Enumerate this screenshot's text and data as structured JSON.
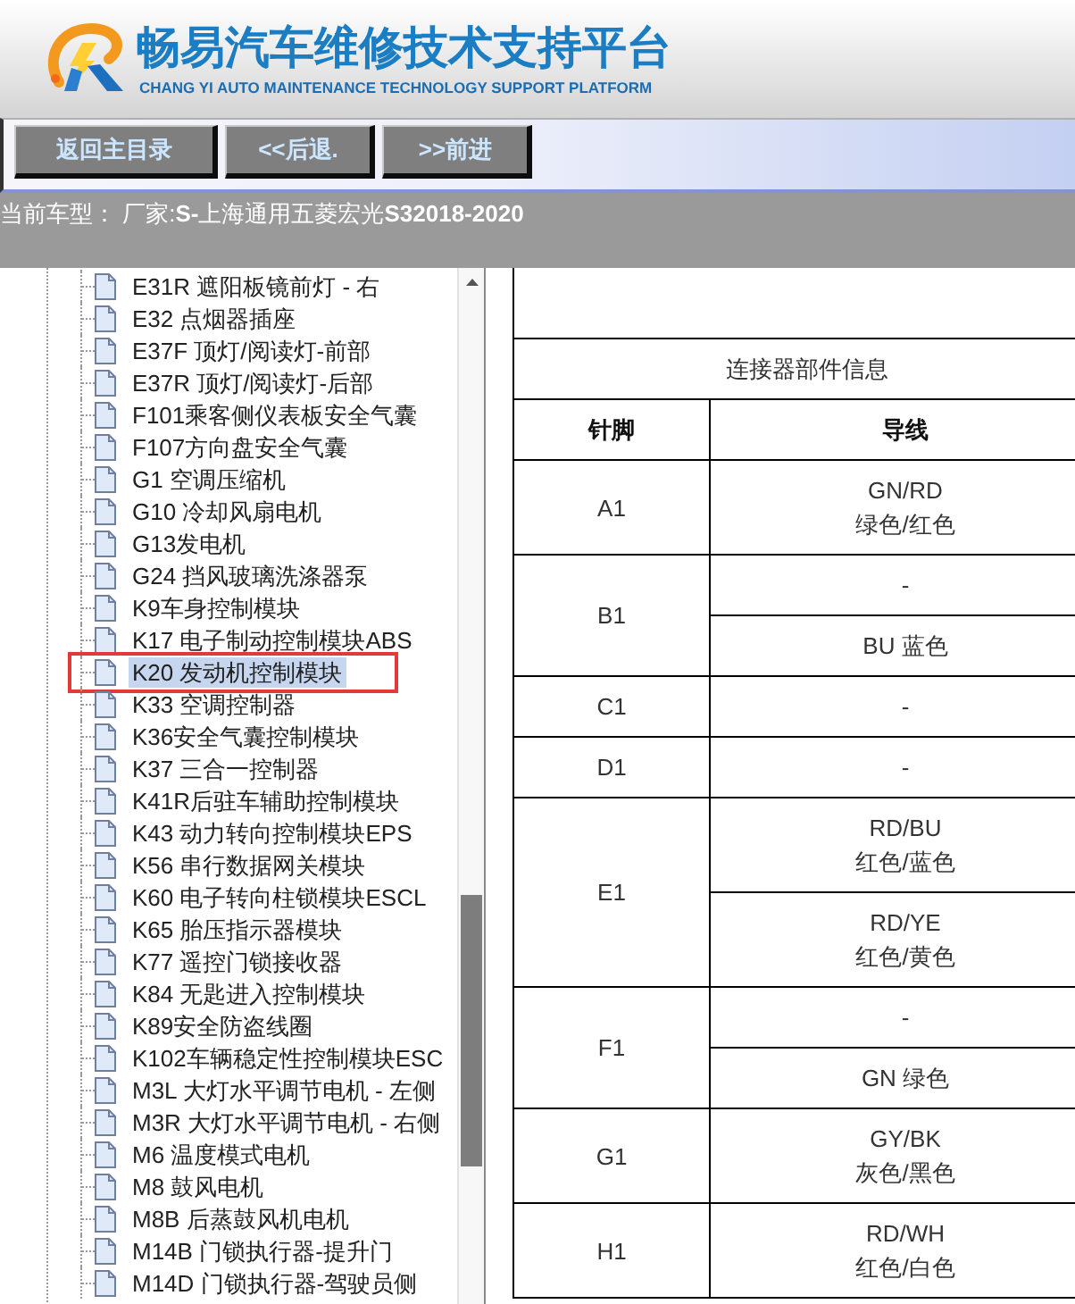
{
  "header": {
    "title": "畅易汽车维修技术支持平台",
    "subtitle": "CHANG YI AUTO MAINTENANCE TECHNOLOGY SUPPORT PLATFORM"
  },
  "nav_buttons": [
    "返回主目录",
    "<<后退.",
    ">>前进"
  ],
  "status_bar": {
    "text": "当前车型： 厂家:**S-**上海通用五菱宏光**S32018-2020**"
  },
  "component_tree": {
    "items": [
      {
        "label": "E31R 遮阳板镜前灯 - 右",
        "selected": false,
        "circled": false
      },
      {
        "label": "E32 点烟器插座",
        "selected": false,
        "circled": false
      },
      {
        "label": "E37F 顶灯/阅读灯-前部",
        "selected": false,
        "circled": false
      },
      {
        "label": "E37R 顶灯/阅读灯-后部",
        "selected": false,
        "circled": false
      },
      {
        "label": "F101乘客侧仪表板安全气囊",
        "selected": false,
        "circled": false
      },
      {
        "label": "F107方向盘安全气囊",
        "selected": false,
        "circled": false
      },
      {
        "label": "G1 空调压缩机",
        "selected": false,
        "circled": false
      },
      {
        "label": "G10 冷却风扇电机",
        "selected": false,
        "circled": false
      },
      {
        "label": "G13发电机",
        "selected": false,
        "circled": false
      },
      {
        "label": "G24 挡风玻璃洗涤器泵",
        "selected": false,
        "circled": false
      },
      {
        "label": "K9车身控制模块",
        "selected": false,
        "circled": false
      },
      {
        "label": "K17 电子制动控制模块ABS",
        "selected": false,
        "circled": false
      },
      {
        "label": "K20 发动机控制模块",
        "selected": true,
        "circled": true
      },
      {
        "label": "K33 空调控制器",
        "selected": false,
        "circled": false
      },
      {
        "label": "K36安全气囊控制模块",
        "selected": false,
        "circled": false
      },
      {
        "label": "K37 三合一控制器",
        "selected": false,
        "circled": false
      },
      {
        "label": "K41R后驻车辅助控制模块",
        "selected": false,
        "circled": false
      },
      {
        "label": "K43 动力转向控制模块EPS",
        "selected": false,
        "circled": false
      },
      {
        "label": "K56 串行数据网关模块",
        "selected": false,
        "circled": false
      },
      {
        "label": "K60 电子转向柱锁模块ESCL",
        "selected": false,
        "circled": false
      },
      {
        "label": "K65 胎压指示器模块",
        "selected": false,
        "circled": false
      },
      {
        "label": "K77 遥控门锁接收器",
        "selected": false,
        "circled": false
      },
      {
        "label": "K84 无匙进入控制模块",
        "selected": false,
        "circled": false
      },
      {
        "label": "K89安全防盗线圈",
        "selected": false,
        "circled": false
      },
      {
        "label": "K102车辆稳定性控制模块ESC",
        "selected": false,
        "circled": false
      },
      {
        "label": "M3L 大灯水平调节电机 - 左侧",
        "selected": false,
        "circled": false
      },
      {
        "label": "M3R 大灯水平调节电机 - 右侧",
        "selected": false,
        "circled": false
      },
      {
        "label": "M6 温度模式电机",
        "selected": false,
        "circled": false
      },
      {
        "label": "M8 鼓风电机",
        "selected": false,
        "circled": false
      },
      {
        "label": "M8B 后蒸鼓风机电机",
        "selected": false,
        "circled": false
      },
      {
        "label": "M14B 门锁执行器-提升门",
        "selected": false,
        "circled": false
      },
      {
        "label": "M14D 门锁执行器-驾驶员侧",
        "selected": false,
        "circled": false
      }
    ]
  },
  "connector_table": {
    "title": "连接器部件信息",
    "columns": [
      "针脚",
      "导线"
    ],
    "rows": [
      {
        "pin": "A1",
        "wires": [
          {
            "lines": [
              "GN/RD",
              "绿色/红色"
            ]
          }
        ]
      },
      {
        "pin": "B1",
        "wires": [
          {
            "lines": [
              "-"
            ]
          },
          {
            "lines": [
              "BU 蓝色"
            ]
          }
        ]
      },
      {
        "pin": "C1",
        "wires": [
          {
            "lines": [
              "-"
            ]
          }
        ]
      },
      {
        "pin": "D1",
        "wires": [
          {
            "lines": [
              "-"
            ]
          }
        ]
      },
      {
        "pin": "E1",
        "wires": [
          {
            "lines": [
              "RD/BU",
              "红色/蓝色"
            ]
          },
          {
            "lines": [
              "RD/YE",
              "红色/黄色"
            ]
          }
        ]
      },
      {
        "pin": "F1",
        "wires": [
          {
            "lines": [
              "-"
            ]
          },
          {
            "lines": [
              "GN 绿色"
            ]
          }
        ]
      },
      {
        "pin": "G1",
        "wires": [
          {
            "lines": [
              "GY/BK",
              "灰色/黑色"
            ]
          }
        ]
      },
      {
        "pin": "H1",
        "wires": [
          {
            "lines": [
              "RD/WH",
              "红色/白色"
            ]
          }
        ]
      }
    ]
  }
}
